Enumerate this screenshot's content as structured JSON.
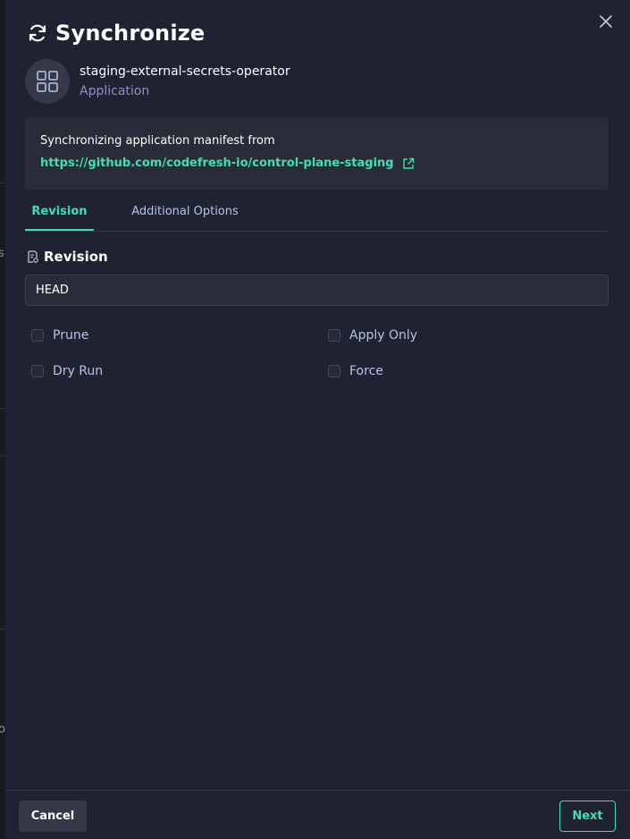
{
  "dialog": {
    "title": "Synchronize",
    "title_icon": "sync-icon",
    "close_icon": "close-icon"
  },
  "application": {
    "name": "staging-external-secrets-operator",
    "type": "Application",
    "icon": "grid-icon"
  },
  "manifest": {
    "text": "Synchronizing application manifest from",
    "link": "https://github.com/codefresh-io/control-plane-staging",
    "link_icon": "external-link-icon"
  },
  "tabs": [
    {
      "label": "Revision",
      "active": true
    },
    {
      "label": "Additional Options",
      "active": false
    }
  ],
  "revision": {
    "section_label": "Revision",
    "section_icon": "revision-icon",
    "value": "HEAD"
  },
  "options": {
    "prune": {
      "label": "Prune",
      "checked": false
    },
    "dry_run": {
      "label": "Dry Run",
      "checked": false
    },
    "apply_only": {
      "label": "Apply Only",
      "checked": false
    },
    "force": {
      "label": "Force",
      "checked": false
    }
  },
  "footer": {
    "cancel_label": "Cancel",
    "next_label": "Next"
  },
  "colors": {
    "accent": "#3ee0b0",
    "background": "#1f2230",
    "panel": "#282c39",
    "muted_text": "#b4c4e8"
  },
  "backdrop": {
    "glyph_s": "s",
    "glyph_o": "o"
  }
}
